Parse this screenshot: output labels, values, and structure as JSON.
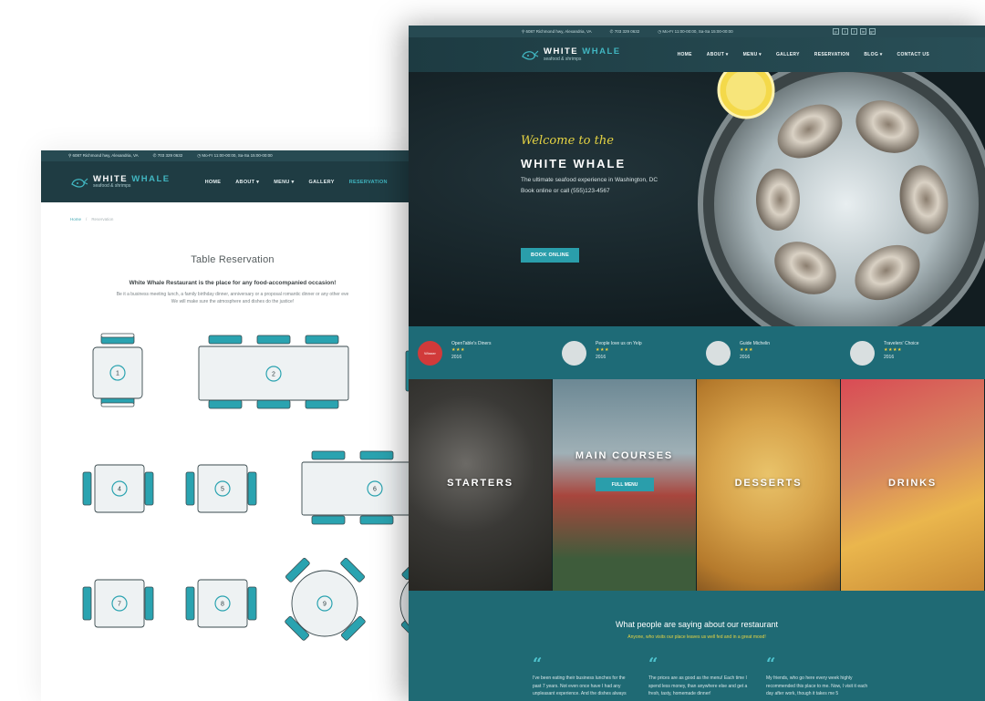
{
  "reservation_page": {
    "topbar": {
      "address": "6087 Richmond hwy, Alexandria, VA",
      "phone": "703 329 0632",
      "hours": "Mo-Fr 11:00-00:00, Sa-Sa 15:00-00:00"
    },
    "logo": {
      "brand_main": "WHITE ",
      "brand_accent": "WHALE",
      "tagline": "seafood & shrimps"
    },
    "nav": {
      "home": "HOME",
      "about": "ABOUT",
      "menu": "MENU",
      "gallery": "GALLERY",
      "reservation": "RESERVATION"
    },
    "breadcrumb": {
      "home": "Home",
      "separator": "/",
      "current": "Reservation"
    },
    "title": "Table Reservation",
    "intro_heading": "White Whale Restaurant is the place for any food-accompanied occasion!",
    "intro_line1": "Be it a business meeting lunch, a family birthday dinner, anniversary or a proposal romantic dinner or any other eve",
    "intro_line2": "We will make sure the atmosphere and dishes do the justice!",
    "tables": [
      "1",
      "2",
      "4",
      "5",
      "6",
      "7",
      "8",
      "9"
    ]
  },
  "home_page": {
    "topbar": {
      "address": "6087 Richmond hwy, Alexandria, VA",
      "phone": "703 329 0632",
      "hours": "Mo-Fr 11:00-00:00, Sa-Sa 15:00-00:00"
    },
    "nav": {
      "home": "HOME",
      "about": "ABOUT ▾",
      "menu": "MENU ▾",
      "gallery": "GALLERY",
      "reservation": "RESERVATION",
      "blog": "BLOG ▾",
      "contact": "CONTACT US"
    },
    "hero": {
      "welcome": "Welcome to the",
      "name": "WHITE WHALE",
      "subtitle": "The ultimate seafood experience in Washington, DC",
      "booking": "Book online or call (555)123-4567",
      "cta": "BOOK ONLINE"
    },
    "ratings": [
      {
        "name": "OpenTable's Diners",
        "stars": "★★★",
        "year": "2016",
        "badge": "Winner"
      },
      {
        "name": "People love us on Yelp",
        "stars": "★★★",
        "year": "2016",
        "badge": ""
      },
      {
        "name": "Guide Michelin",
        "stars": "★★★",
        "year": "2016",
        "badge": ""
      },
      {
        "name": "Travelers' Choice",
        "stars": "★★★★",
        "year": "2016",
        "badge": ""
      }
    ],
    "categories": {
      "starters": "STARTERS",
      "main_courses": "MAIN COURSES",
      "full_menu": "FULL MENU",
      "desserts": "DESSERTS",
      "drinks": "DRINKS"
    },
    "testimonials": {
      "heading": "What people are saying about our restaurant",
      "subheading": "Anyone, who visits our place leaves us well fed and in a great mood!",
      "quotes": [
        {
          "mark": "“",
          "text": "I've been eating their business lunches for the past 7 years. Not even once have I had any unpleasant experience. And the dishes always"
        },
        {
          "mark": "“",
          "text": "The prices are as good as the menu! Each time I spend less money, than anywhere else and get a fresh, tasty, homemade dinner!"
        },
        {
          "mark": "“",
          "text": "My friends, who go here every week highly recommended this place to me. Now, I visit it each day after work, though it takes me 5"
        }
      ]
    },
    "socials": [
      "p",
      "t",
      "f",
      "in",
      "g+"
    ]
  },
  "colors": {
    "teal_accent": "#2a9eab",
    "dark_header": "#1f3c43",
    "topbar": "#274a52",
    "rating_bar": "#1e6b77",
    "headline_yellow": "#e6d443"
  }
}
